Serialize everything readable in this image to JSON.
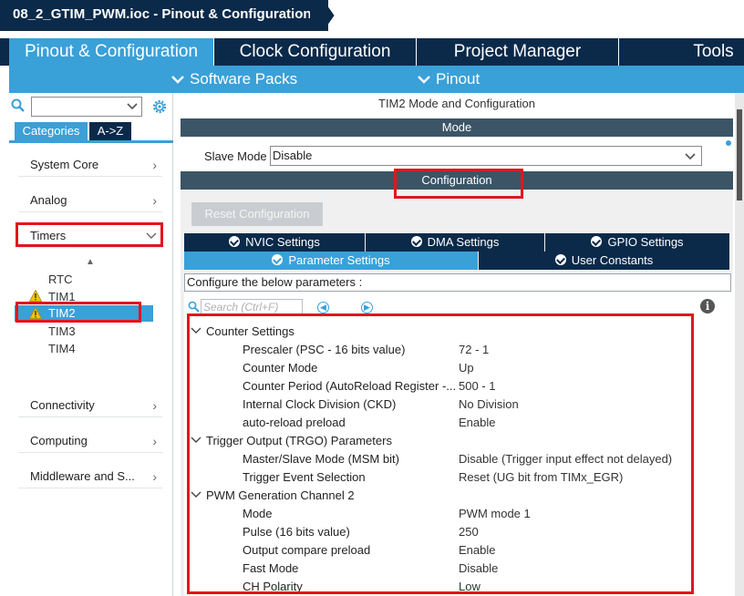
{
  "titlebar": {
    "file": "08_2_GTIM_PWM.ioc",
    "separator": " - ",
    "view": "Pinout & Configuration"
  },
  "main_tabs": [
    "Pinout & Configuration",
    "Clock Configuration",
    "Project Manager",
    "Tools"
  ],
  "sub_menu": [
    "Software Packs",
    "Pinout"
  ],
  "left": {
    "category_tabs": [
      "Categories",
      "A->Z"
    ],
    "categories": [
      "System Core",
      "Analog",
      "Timers",
      "Connectivity",
      "Computing",
      "Middleware and S..."
    ],
    "timers": [
      "RTC",
      "TIM1",
      "TIM2",
      "TIM3",
      "TIM4"
    ]
  },
  "right": {
    "title": "TIM2 Mode and Configuration",
    "mode_header": "Mode",
    "slave_mode_label": "Slave Mode",
    "slave_mode_value": "Disable",
    "configuration_header": "Configuration",
    "reset_button": "Reset Configuration",
    "settings_tabs_row1": [
      "NVIC Settings",
      "DMA Settings",
      "GPIO Settings"
    ],
    "settings_tabs_row2": [
      "Parameter Settings",
      "User Constants"
    ],
    "params_header": "Configure the below parameters :",
    "search_placeholder": "Search (Ctrl+F)",
    "info": "i",
    "groups": [
      {
        "name": "Counter Settings",
        "rows": [
          {
            "name": "Prescaler (PSC - 16 bits value)",
            "value": "72 - 1"
          },
          {
            "name": "Counter Mode",
            "value": "Up"
          },
          {
            "name": "Counter Period (AutoReload Register -...",
            "value": "500 - 1"
          },
          {
            "name": "Internal Clock Division (CKD)",
            "value": "No Division"
          },
          {
            "name": "auto-reload preload",
            "value": "Enable"
          }
        ]
      },
      {
        "name": "Trigger Output (TRGO) Parameters",
        "rows": [
          {
            "name": "Master/Slave Mode (MSM bit)",
            "value": "Disable (Trigger input effect not delayed)"
          },
          {
            "name": "Trigger Event Selection",
            "value": "Reset (UG bit from TIMx_EGR)"
          }
        ]
      },
      {
        "name": "PWM Generation Channel 2",
        "rows": [
          {
            "name": "Mode",
            "value": "PWM mode 1"
          },
          {
            "name": "Pulse (16 bits value)",
            "value": "250"
          },
          {
            "name": "Output compare preload",
            "value": "Enable"
          },
          {
            "name": "Fast Mode",
            "value": "Disable"
          },
          {
            "name": "CH Polarity",
            "value": "Low"
          }
        ]
      }
    ]
  },
  "colors": {
    "navy": "#0b2a4a",
    "accent": "#3aa0d8",
    "highlight": "#e0161e",
    "warning": "#f5c400"
  }
}
